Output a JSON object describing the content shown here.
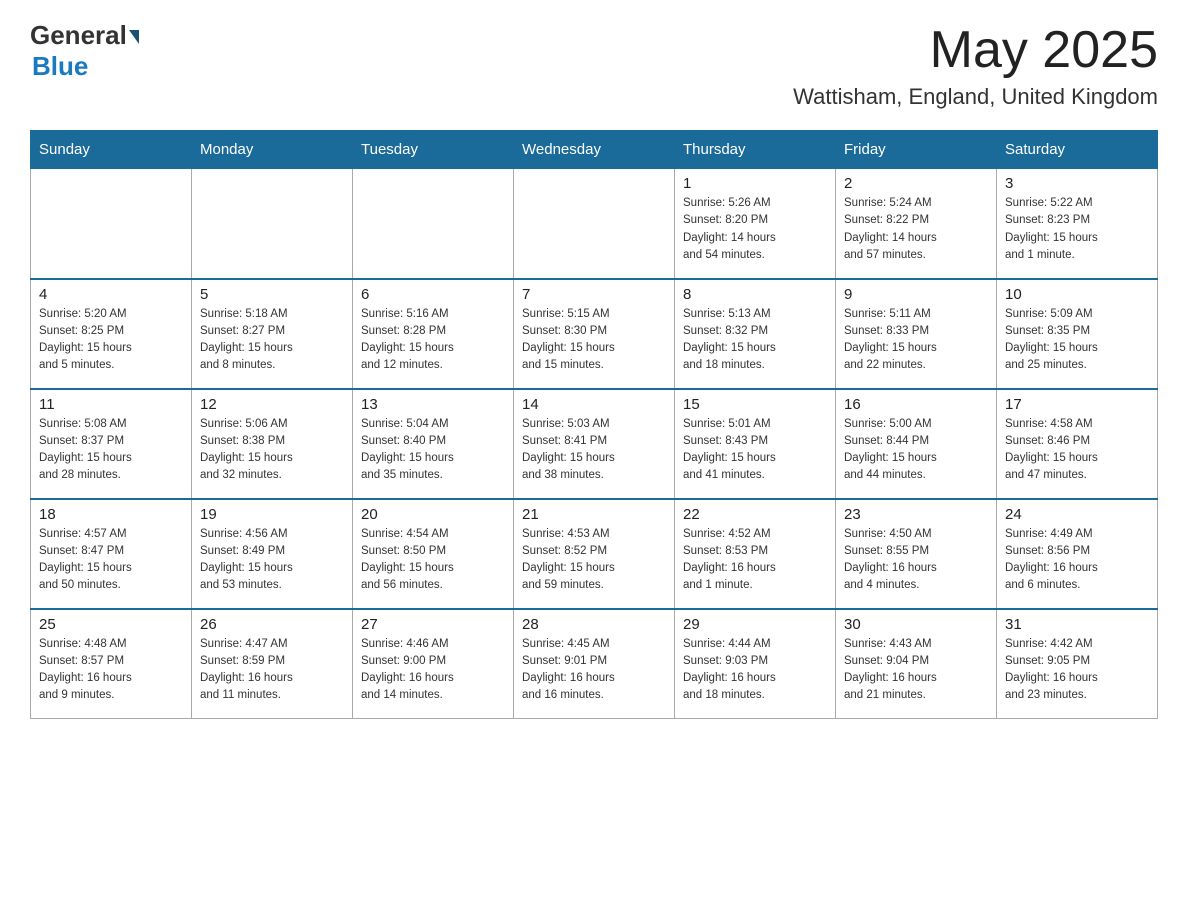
{
  "header": {
    "logo_general": "General",
    "logo_blue": "Blue",
    "main_title": "May 2025",
    "subtitle": "Wattisham, England, United Kingdom"
  },
  "calendar": {
    "days_of_week": [
      "Sunday",
      "Monday",
      "Tuesday",
      "Wednesday",
      "Thursday",
      "Friday",
      "Saturday"
    ],
    "weeks": [
      [
        {
          "day": "",
          "info": ""
        },
        {
          "day": "",
          "info": ""
        },
        {
          "day": "",
          "info": ""
        },
        {
          "day": "",
          "info": ""
        },
        {
          "day": "1",
          "info": "Sunrise: 5:26 AM\nSunset: 8:20 PM\nDaylight: 14 hours\nand 54 minutes."
        },
        {
          "day": "2",
          "info": "Sunrise: 5:24 AM\nSunset: 8:22 PM\nDaylight: 14 hours\nand 57 minutes."
        },
        {
          "day": "3",
          "info": "Sunrise: 5:22 AM\nSunset: 8:23 PM\nDaylight: 15 hours\nand 1 minute."
        }
      ],
      [
        {
          "day": "4",
          "info": "Sunrise: 5:20 AM\nSunset: 8:25 PM\nDaylight: 15 hours\nand 5 minutes."
        },
        {
          "day": "5",
          "info": "Sunrise: 5:18 AM\nSunset: 8:27 PM\nDaylight: 15 hours\nand 8 minutes."
        },
        {
          "day": "6",
          "info": "Sunrise: 5:16 AM\nSunset: 8:28 PM\nDaylight: 15 hours\nand 12 minutes."
        },
        {
          "day": "7",
          "info": "Sunrise: 5:15 AM\nSunset: 8:30 PM\nDaylight: 15 hours\nand 15 minutes."
        },
        {
          "day": "8",
          "info": "Sunrise: 5:13 AM\nSunset: 8:32 PM\nDaylight: 15 hours\nand 18 minutes."
        },
        {
          "day": "9",
          "info": "Sunrise: 5:11 AM\nSunset: 8:33 PM\nDaylight: 15 hours\nand 22 minutes."
        },
        {
          "day": "10",
          "info": "Sunrise: 5:09 AM\nSunset: 8:35 PM\nDaylight: 15 hours\nand 25 minutes."
        }
      ],
      [
        {
          "day": "11",
          "info": "Sunrise: 5:08 AM\nSunset: 8:37 PM\nDaylight: 15 hours\nand 28 minutes."
        },
        {
          "day": "12",
          "info": "Sunrise: 5:06 AM\nSunset: 8:38 PM\nDaylight: 15 hours\nand 32 minutes."
        },
        {
          "day": "13",
          "info": "Sunrise: 5:04 AM\nSunset: 8:40 PM\nDaylight: 15 hours\nand 35 minutes."
        },
        {
          "day": "14",
          "info": "Sunrise: 5:03 AM\nSunset: 8:41 PM\nDaylight: 15 hours\nand 38 minutes."
        },
        {
          "day": "15",
          "info": "Sunrise: 5:01 AM\nSunset: 8:43 PM\nDaylight: 15 hours\nand 41 minutes."
        },
        {
          "day": "16",
          "info": "Sunrise: 5:00 AM\nSunset: 8:44 PM\nDaylight: 15 hours\nand 44 minutes."
        },
        {
          "day": "17",
          "info": "Sunrise: 4:58 AM\nSunset: 8:46 PM\nDaylight: 15 hours\nand 47 minutes."
        }
      ],
      [
        {
          "day": "18",
          "info": "Sunrise: 4:57 AM\nSunset: 8:47 PM\nDaylight: 15 hours\nand 50 minutes."
        },
        {
          "day": "19",
          "info": "Sunrise: 4:56 AM\nSunset: 8:49 PM\nDaylight: 15 hours\nand 53 minutes."
        },
        {
          "day": "20",
          "info": "Sunrise: 4:54 AM\nSunset: 8:50 PM\nDaylight: 15 hours\nand 56 minutes."
        },
        {
          "day": "21",
          "info": "Sunrise: 4:53 AM\nSunset: 8:52 PM\nDaylight: 15 hours\nand 59 minutes."
        },
        {
          "day": "22",
          "info": "Sunrise: 4:52 AM\nSunset: 8:53 PM\nDaylight: 16 hours\nand 1 minute."
        },
        {
          "day": "23",
          "info": "Sunrise: 4:50 AM\nSunset: 8:55 PM\nDaylight: 16 hours\nand 4 minutes."
        },
        {
          "day": "24",
          "info": "Sunrise: 4:49 AM\nSunset: 8:56 PM\nDaylight: 16 hours\nand 6 minutes."
        }
      ],
      [
        {
          "day": "25",
          "info": "Sunrise: 4:48 AM\nSunset: 8:57 PM\nDaylight: 16 hours\nand 9 minutes."
        },
        {
          "day": "26",
          "info": "Sunrise: 4:47 AM\nSunset: 8:59 PM\nDaylight: 16 hours\nand 11 minutes."
        },
        {
          "day": "27",
          "info": "Sunrise: 4:46 AM\nSunset: 9:00 PM\nDaylight: 16 hours\nand 14 minutes."
        },
        {
          "day": "28",
          "info": "Sunrise: 4:45 AM\nSunset: 9:01 PM\nDaylight: 16 hours\nand 16 minutes."
        },
        {
          "day": "29",
          "info": "Sunrise: 4:44 AM\nSunset: 9:03 PM\nDaylight: 16 hours\nand 18 minutes."
        },
        {
          "day": "30",
          "info": "Sunrise: 4:43 AM\nSunset: 9:04 PM\nDaylight: 16 hours\nand 21 minutes."
        },
        {
          "day": "31",
          "info": "Sunrise: 4:42 AM\nSunset: 9:05 PM\nDaylight: 16 hours\nand 23 minutes."
        }
      ]
    ]
  }
}
